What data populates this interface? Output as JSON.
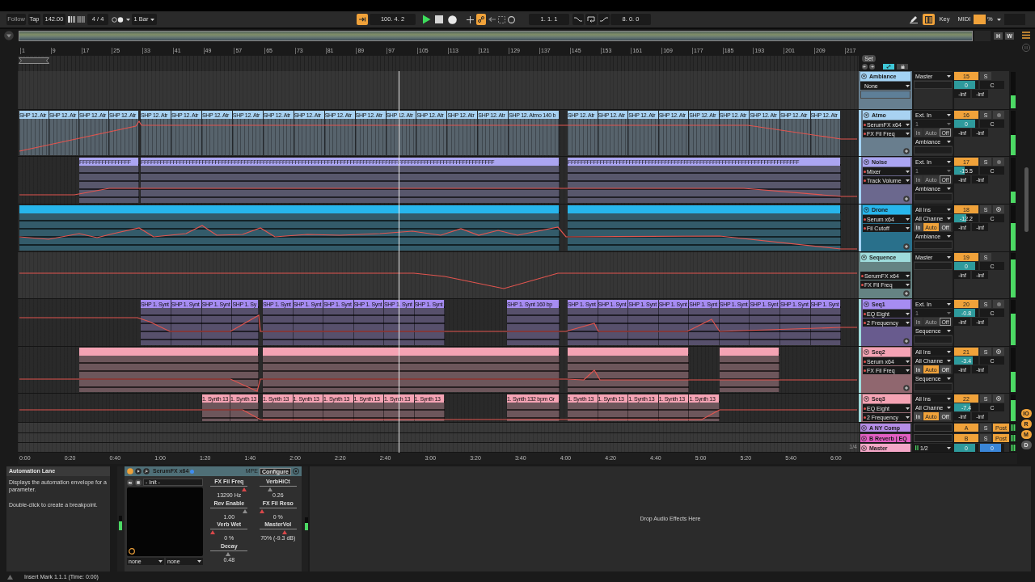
{
  "control_bar": {
    "follow": {
      "label": "Follow",
      "on": false
    },
    "tap": "Tap",
    "tempo": "142.00",
    "time_signature": "4 / 4",
    "quantization": "1 Bar",
    "arrow_toggle": {
      "on": true
    },
    "position": "100. 4. 2",
    "playing": true,
    "automation_arm": {
      "on": true
    },
    "loop_start": "1. 1. 1",
    "loop_length": "8. 0. 0",
    "computer_keyboard": {
      "on": true
    },
    "key_map": "Key",
    "midi_map": "MIDI",
    "cpu_unit": "%"
  },
  "overview": {
    "buttons": [
      "H",
      "W"
    ]
  },
  "beat_ruler": {
    "ticks": [
      "1",
      "9",
      "17",
      "25",
      "33",
      "41",
      "49",
      "57",
      "65",
      "73",
      "81",
      "89",
      "97",
      "105",
      "113",
      "121",
      "129",
      "137",
      "145",
      "153",
      "161",
      "169",
      "177",
      "185",
      "193",
      "201",
      "209",
      "217"
    ]
  },
  "mixer_header": {
    "set": "Set",
    "expand": {
      "on": true
    }
  },
  "tracks": [
    {
      "name": "Ambiance",
      "kind": "group",
      "color": "#a3d3f5",
      "expanded": true,
      "device": {
        "label": "None",
        "automated": false
      },
      "output": "Master",
      "number": "15",
      "solo": "S",
      "volume": {
        "value": "0",
        "level": 0.88
      },
      "pan": "C",
      "peaks": [
        "-inf",
        "-inf"
      ],
      "meter": {
        "level": 0.35
      },
      "children": [
        {
          "name": "Atmo",
          "kind": "midi",
          "color": "#a8d2f2",
          "expanded": true,
          "device": {
            "label": "SerumFX x64",
            "automated": true
          },
          "parameter": {
            "label": "FX Fil Freq",
            "automated": true
          },
          "input_type": "Ext. In",
          "input_channel": {
            "label": "1",
            "disabled": true
          },
          "monitor": {
            "disabled": true,
            "options": [
              {
                "label": "In",
                "selected": false
              },
              {
                "label": "Auto",
                "selected": false
              },
              {
                "label": "Off",
                "selected": true
              }
            ]
          },
          "output": "Ambiance",
          "number": "16",
          "solo": "S",
          "arm_button": {
            "kind": "dot"
          },
          "volume": {
            "value": "0",
            "level": 0.88
          },
          "pan": "C",
          "peaks": [
            "-inf",
            "-inf"
          ],
          "meter": {
            "level": 0.45
          },
          "clips": [
            {
              "kind": "audio",
              "titles": [
                "SHP 12. Atr",
                "SHP 12. Atr",
                "SHP 12. Atr",
                "SHP 12. Atr"
              ]
            },
            {
              "kind": "audio",
              "titles": [
                "SHP 12. Atr",
                "SHP 12. Atr",
                "SHP 12. Atr",
                "SHP 12. Atr",
                "SHP 12. Atr",
                "SHP 12. Atr",
                "SHP 12. Atr",
                "SHP 12. Atr",
                "SHP 12. Atr",
                "SHP 12. Atr",
                "SHP 12. Atr",
                "SHP 12. Atr",
                "SHP 12. Atmo 140 b"
              ]
            },
            {
              "kind": "audio",
              "titles": [
                "SHP 12. Atr",
                "SHP 12. Atr",
                "SHP 12. Atr",
                "SHP 12. Atr",
                "SHP 12. Atr",
                "SHP 12. Atr",
                "SHP 12. Atr",
                "SHP 12. Atr",
                "SHP 12. Atr"
              ]
            }
          ]
        },
        {
          "name": "Noise",
          "kind": "midi",
          "color": "#aba5f2",
          "expanded": true,
          "device": {
            "label": "Mixer",
            "automated": true
          },
          "parameter": {
            "label": "Track Volume",
            "automated": true
          },
          "input_type": "Ext. In",
          "input_channel": {
            "label": "1",
            "disabled": true
          },
          "monitor": {
            "disabled": true,
            "options": [
              {
                "label": "In",
                "selected": false
              },
              {
                "label": "Auto",
                "selected": false
              },
              {
                "label": "Off",
                "selected": true
              }
            ]
          },
          "output": "Ambiance",
          "number": "17",
          "solo": "S",
          "arm_button": {
            "kind": "dot"
          },
          "volume": {
            "value": "-15.5",
            "level": 0.42
          },
          "pan": "C",
          "peaks": [
            "-inf",
            "-inf"
          ],
          "meter": {
            "level": 0.25
          },
          "clips": [
            {
              "kind": "midi",
              "titles": [
                "FFFFFFFFFFFFFFFF"
              ]
            },
            {
              "kind": "midi",
              "titles": [
                "FFFFFFFFFFFFFFFFFFFFFFFFFFFFFFFFFFFFFFFFFFFFFFFFFFFFFFFFFFFFFFFFFFFFFFFFFFFFFFFFFFFFFFFFFFFFFFFFFFFFFFFFFFFFFF"
              ]
            },
            {
              "kind": "midi",
              "titles": [
                "FFFFFFFFFFFFFFFFFFFFFFFFFFFFFFFFFFFFFFFFFFFFFFFFFFFFFFFFFFFFFFFFFFFFFFFF"
              ]
            }
          ]
        },
        {
          "name": "Drone",
          "kind": "midi",
          "color": "#27b6ec",
          "expanded": true,
          "device": {
            "label": "Serum x64",
            "automated": true
          },
          "parameter": {
            "label": "Fil Cutoff",
            "automated": true
          },
          "input_type": "All Ins",
          "input_channel": {
            "label": "All Channe",
            "disabled": false
          },
          "monitor": {
            "disabled": false,
            "options": [
              {
                "label": "In",
                "selected": false
              },
              {
                "label": "Auto",
                "selected": true
              },
              {
                "label": "Off",
                "selected": false
              }
            ]
          },
          "output": "Ambiance",
          "number": "18",
          "solo": "S",
          "arm_button": {
            "kind": "ring"
          },
          "volume": {
            "value": "-12.2",
            "level": 0.5
          },
          "pan": "C",
          "peaks": [
            "-inf",
            "-inf"
          ],
          "meter": {
            "level": 0.6
          },
          "clips": [
            {
              "kind": "midi"
            },
            {
              "kind": "midi"
            }
          ]
        }
      ]
    },
    {
      "name": "Sequence",
      "kind": "group",
      "color": "#9fdcdc",
      "expanded": true,
      "device": {
        "label": "SerumFX x64",
        "automated": true
      },
      "parameter": {
        "label": "FX Fil Freq",
        "automated": true
      },
      "output": "Master",
      "number": "19",
      "solo": "S",
      "volume": {
        "value": "0",
        "level": 0.88
      },
      "pan": "C",
      "peaks": [
        "-inf",
        "-inf"
      ],
      "meter": {
        "level": 0.85
      },
      "children": [
        {
          "name": "Seq1",
          "kind": "midi",
          "color": "#a68cf2",
          "expanded": true,
          "device": {
            "label": "EQ Eight",
            "automated": true
          },
          "parameter": {
            "label": "2 Frequency",
            "automated": true
          },
          "input_type": "Ext. In",
          "input_channel": {
            "label": "1",
            "disabled": true
          },
          "monitor": {
            "disabled": true,
            "options": [
              {
                "label": "In",
                "selected": false
              },
              {
                "label": "Auto",
                "selected": false
              },
              {
                "label": "Off",
                "selected": true
              }
            ]
          },
          "output": "Sequence",
          "number": "20",
          "solo": "S",
          "arm_button": {
            "kind": "dot"
          },
          "volume": {
            "value": "-0.8",
            "level": 0.85
          },
          "pan": "C",
          "peaks": [
            "-inf",
            "-inf"
          ],
          "meter": {
            "level": 0.7
          },
          "clips": [
            {
              "kind": "midi",
              "titles": [
                "SHP 1. Synt",
                "SHP 1. Synt",
                "SHP 1. Synt",
                "SHP 1. Sy"
              ]
            },
            {
              "kind": "midi",
              "titles": [
                "SHP 1. Synt",
                "SHP 1. Synt",
                "SHP 1. Synt",
                "SHP 1. Synt",
                "SHP 1. Synt",
                "SHP 1. Synt"
              ]
            },
            {
              "kind": "midi",
              "titles": [
                "SHP 1. Synt 160 bp"
              ]
            },
            {
              "kind": "midi",
              "titles": [
                "SHP 1. Synt",
                "SHP 1. Synt",
                "SHP 1. Synt",
                "SHP 1. Synt",
                "SHP 1. Synt",
                "SHP 1. Synt",
                "SHP 1. Synt",
                "SHP 1. Synt",
                "SHP 1. Synt"
              ]
            }
          ]
        },
        {
          "name": "Seq2",
          "kind": "midi",
          "color": "#f5a3b4",
          "expanded": true,
          "device": {
            "label": "Serum x64",
            "automated": true
          },
          "parameter": {
            "label": "FX Fil Freq",
            "automated": true
          },
          "input_type": "All Ins",
          "input_channel": {
            "label": "All Channe",
            "disabled": false
          },
          "monitor": {
            "disabled": false,
            "options": [
              {
                "label": "In",
                "selected": false
              },
              {
                "label": "Auto",
                "selected": true
              },
              {
                "label": "Off",
                "selected": false
              }
            ]
          },
          "output": "Sequence",
          "number": "21",
          "solo": "S",
          "arm_button": {
            "kind": "ring"
          },
          "volume": {
            "value": "-3.4",
            "level": 0.78
          },
          "pan": "C",
          "peaks": [
            "-inf",
            "-inf"
          ],
          "meter": {
            "level": 0.45
          },
          "clips": [
            {
              "kind": "midi"
            },
            {
              "kind": "midi"
            },
            {
              "kind": "midi"
            },
            {
              "kind": "midi"
            }
          ]
        },
        {
          "name": "Seq3",
          "kind": "midi",
          "color": "#f5a3b4",
          "expanded": true,
          "device": {
            "label": "EQ Eight",
            "automated": true
          },
          "parameter": {
            "label": "2 Frequency",
            "automated": true
          },
          "input_type": "All Ins",
          "input_channel": {
            "label": "All Channe",
            "disabled": false
          },
          "monitor": {
            "disabled": false,
            "options": [
              {
                "label": "In",
                "selected": false
              },
              {
                "label": "Auto",
                "selected": true
              },
              {
                "label": "Off",
                "selected": false
              }
            ]
          },
          "number": "22",
          "solo": "S",
          "arm_button": {
            "kind": "ring"
          },
          "volume": {
            "value": "-7.4",
            "level": 0.68
          },
          "pan": "C",
          "peaks": [
            "-inf",
            "-inf"
          ],
          "meter": {
            "level": 0.8
          },
          "clips": [
            {
              "kind": "midi",
              "titles": [
                "1. Synth 13",
                "1. Synth 13"
              ]
            },
            {
              "kind": "midi",
              "titles": [
                "1. Synth 13",
                "1. Synth 13",
                "1. Synth 13",
                "1. Synth 13",
                "1. Synth 13",
                "1. Synth 13"
              ]
            },
            {
              "kind": "midi",
              "titles": [
                "1. Synth 132 bpm Gr"
              ]
            },
            {
              "kind": "midi",
              "titles": [
                "1. Synth 13",
                "1. Synth 13",
                "1. Synth 13",
                "1. Synth 13",
                "1. Synth 13"
              ]
            }
          ]
        }
      ]
    }
  ],
  "return_tracks": [
    {
      "name": "A NY Comp",
      "kind": "return",
      "color": "#b58de6",
      "expanded": false,
      "number": "A",
      "solo": "S",
      "send_mode": {
        "label": "Post",
        "on": true
      }
    },
    {
      "name": "B Reverb | EQ",
      "kind": "return",
      "color": "#e25fc2",
      "expanded": false,
      "number": "B",
      "solo": "S",
      "send_mode": {
        "label": "Post",
        "on": true
      }
    }
  ],
  "master_track": {
    "name": "Master",
    "kind": "master",
    "color": "#f4a7c7",
    "expanded": false,
    "output": "1/2",
    "volume": {
      "value": "0",
      "level": 0.88
    },
    "cue": {
      "value": "0",
      "level": 0.88
    }
  },
  "arrangement": {
    "grid_label": "1/4"
  },
  "time_ruler": {
    "ticks": [
      "0:00",
      "0:20",
      "0:40",
      "1:00",
      "1:20",
      "1:40",
      "2:00",
      "2:20",
      "2:40",
      "3:00",
      "3:20",
      "3:40",
      "4:00",
      "4:20",
      "4:40",
      "5:00",
      "5:20",
      "5:40",
      "6:00"
    ]
  },
  "side_buttons": [
    {
      "label": "IO",
      "on": true
    },
    {
      "label": "R",
      "on": true
    },
    {
      "label": "M",
      "on": true
    },
    {
      "label": "D",
      "on": false
    }
  ],
  "info_view": {
    "title": "Automation Lane",
    "paragraphs": [
      "Displays the automation envelope for a parameter.",
      "Double-click to create a breakpoint."
    ]
  },
  "device": {
    "name": "SerumFX x64",
    "on": true,
    "mpe": "MPE",
    "configure": "Configure",
    "preset": "- Init -",
    "selectors": [
      "none",
      "none"
    ],
    "meters": [
      {
        "level": 0.6
      },
      {
        "level": 0.55
      }
    ],
    "parameters": [
      {
        "name": "FX Fil Freq",
        "value": "13290 Hz",
        "level": 0.97,
        "automated": true
      },
      {
        "name": "VerbHiCt",
        "value": "0.26",
        "level": 0.26,
        "automated": false
      },
      {
        "name": "Rev Enable",
        "value": "1.00",
        "level": 1,
        "automated": false
      },
      {
        "name": "FX Fil Reso",
        "value": "0 %",
        "level": 0,
        "automated": true
      },
      {
        "name": "Verb Wet",
        "value": "0 %",
        "level": 0,
        "automated": true
      },
      {
        "name": "MasterVol",
        "value": "70% (-9.3 dB)",
        "level": 0.7,
        "automated": true
      },
      {
        "name": "Decay",
        "value": "0.48",
        "level": 0.48,
        "automated": false
      }
    ]
  },
  "drop_zone": "Drop Audio Effects Here",
  "status_bar": "Insert Mark 1.1.1 (Time: 0:00)"
}
